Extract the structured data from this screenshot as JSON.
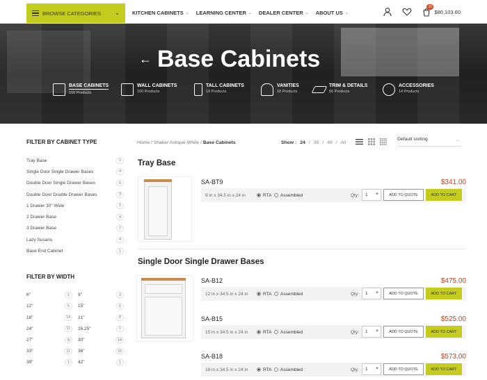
{
  "header": {
    "browse_label": "BROWSE CATEGORIES",
    "nav": [
      {
        "label": "KITCHEN CABINETS"
      },
      {
        "label": "LEARNING CENTER"
      },
      {
        "label": "DEALER CENTER"
      },
      {
        "label": "ABOUT US"
      }
    ],
    "cart_count": "15",
    "cart_total": "$80,103.60"
  },
  "hero": {
    "title": "Base Cabinets",
    "categories": [
      {
        "name": "BASE CABINETS",
        "count": "100 Products"
      },
      {
        "name": "WALL CABINETS",
        "count": "100 Products"
      },
      {
        "name": "TALL CABINETS",
        "count": "19 Products"
      },
      {
        "name": "VANITIES",
        "count": "18 Products"
      },
      {
        "name": "TRIM & DETAILS",
        "count": "56 Products"
      },
      {
        "name": "ACCESSORIES",
        "count": "14 Products"
      }
    ]
  },
  "sidebar": {
    "type_title": "FILTER BY CABINET TYPE",
    "types": [
      {
        "label": "Tray Base",
        "count": "1"
      },
      {
        "label": "Single Door Single Drawer Bases",
        "count": "4"
      },
      {
        "label": "Double Door Single Drawer Bases",
        "count": "6"
      },
      {
        "label": "Double Door Double Drawer Bases",
        "count": "3"
      },
      {
        "label": "1 Drawer 30\" Wide",
        "count": "1"
      },
      {
        "label": "2 Drawer Base",
        "count": "4"
      },
      {
        "label": "3 Drawer Base",
        "count": "7"
      },
      {
        "label": "Lazy Susans",
        "count": "4"
      },
      {
        "label": "Base End Cabinet",
        "count": "1"
      }
    ],
    "width_title": "FILTER BY WIDTH",
    "widths": [
      {
        "label": "6\"",
        "count": "1"
      },
      {
        "label": "9\"",
        "count": "3"
      },
      {
        "label": "12\"",
        "count": "5"
      },
      {
        "label": "15\"",
        "count": "6"
      },
      {
        "label": "18\"",
        "count": "14"
      },
      {
        "label": "21\"",
        "count": "8"
      },
      {
        "label": "24\"",
        "count": "11"
      },
      {
        "label": "26.25\"",
        "count": "1"
      },
      {
        "label": "27\"",
        "count": "8"
      },
      {
        "label": "30\"",
        "count": "14"
      },
      {
        "label": "33\"",
        "count": "11"
      },
      {
        "label": "36\"",
        "count": "15"
      },
      {
        "label": "39\"",
        "count": "1"
      },
      {
        "label": "42\"",
        "count": "1"
      }
    ]
  },
  "toolbar": {
    "crumb_home": "Home",
    "crumb_mid": "Shaker Antique White",
    "crumb_current": "Base Cabinets",
    "show_label": "Show :",
    "show_options": [
      "24",
      "36",
      "48",
      "All"
    ],
    "sort_label": "Default sorting"
  },
  "sections": [
    {
      "title": "Tray Base"
    },
    {
      "title": "Single Door Single Drawer Bases"
    }
  ],
  "products": [
    {
      "sku": "SA-BT9",
      "price": "$341.00",
      "dims": "9 in x 34.5 in x 24 in",
      "rta": "RTA",
      "assembled": "Assembled",
      "qty_label": "Qty:",
      "qty": "1",
      "quote": "ADD TO QUOTE",
      "cart": "ADD TO CART"
    },
    {
      "sku": "SA-B12",
      "price": "$475.00",
      "dims": "12 in x 34.5 in x 24 in",
      "rta": "RTA",
      "assembled": "Assembled",
      "qty_label": "Qty:",
      "qty": "1",
      "quote": "ADD TO QUOTE",
      "cart": "ADD TO CART"
    },
    {
      "sku": "SA-B15",
      "price": "$525.00",
      "dims": "15 in x 34.5 in x 24 in",
      "rta": "RTA",
      "assembled": "Assembled",
      "qty_label": "Qty:",
      "qty": "1",
      "quote": "ADD TO QUOTE",
      "cart": "ADD TO CART"
    },
    {
      "sku": "SA-B18",
      "price": "$573.00",
      "dims": "18 in x 34.5 in x 24 in",
      "rta": "RTA",
      "assembled": "Assembled",
      "qty_label": "Qty:",
      "qty": "1",
      "quote": "ADD TO QUOTE",
      "cart": "ADD TO CART"
    }
  ]
}
